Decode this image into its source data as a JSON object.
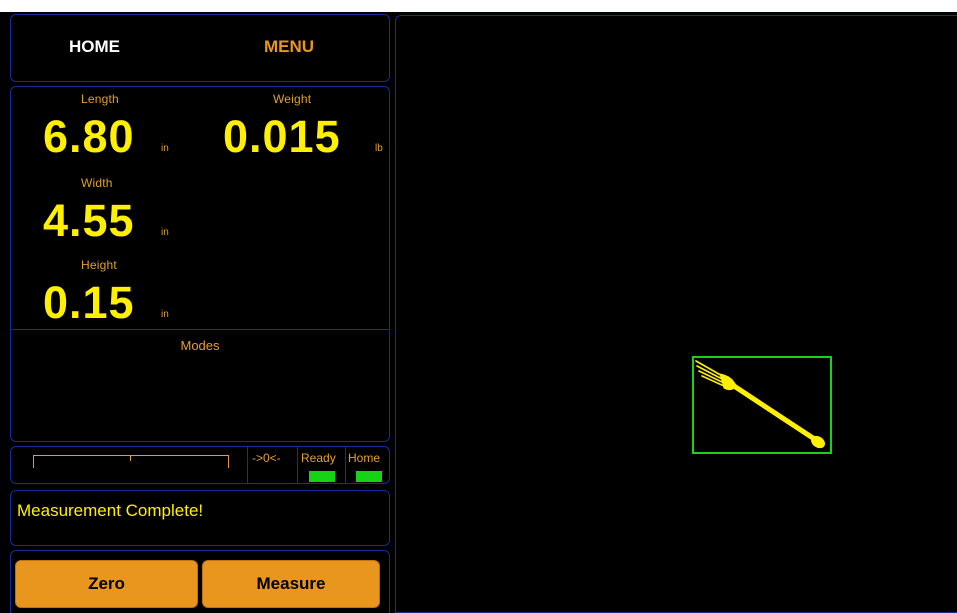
{
  "nav": {
    "home_label": "HOME",
    "menu_label": "MENU"
  },
  "measurements": {
    "length": {
      "label": "Length",
      "value": "6.80",
      "unit": "in"
    },
    "weight": {
      "label": "Weight",
      "value": "0.015",
      "unit": "lb"
    },
    "width": {
      "label": "Width",
      "value": "4.55",
      "unit": "in"
    },
    "height": {
      "label": "Height",
      "value": "0.15",
      "unit": "in"
    }
  },
  "modes": {
    "title": "Modes"
  },
  "status": {
    "zero_label": "->0<-",
    "ready_label": "Ready",
    "home_label": "Home",
    "ready_color": "#14d414",
    "home_color": "#14d414"
  },
  "message": {
    "text": "Measurement Complete!"
  },
  "buttons": {
    "zero_label": "Zero",
    "measure_label": "Measure"
  },
  "viewer": {
    "object_icon": "fork-icon",
    "box_color": "#14d414",
    "object_color": "#ffef00"
  }
}
